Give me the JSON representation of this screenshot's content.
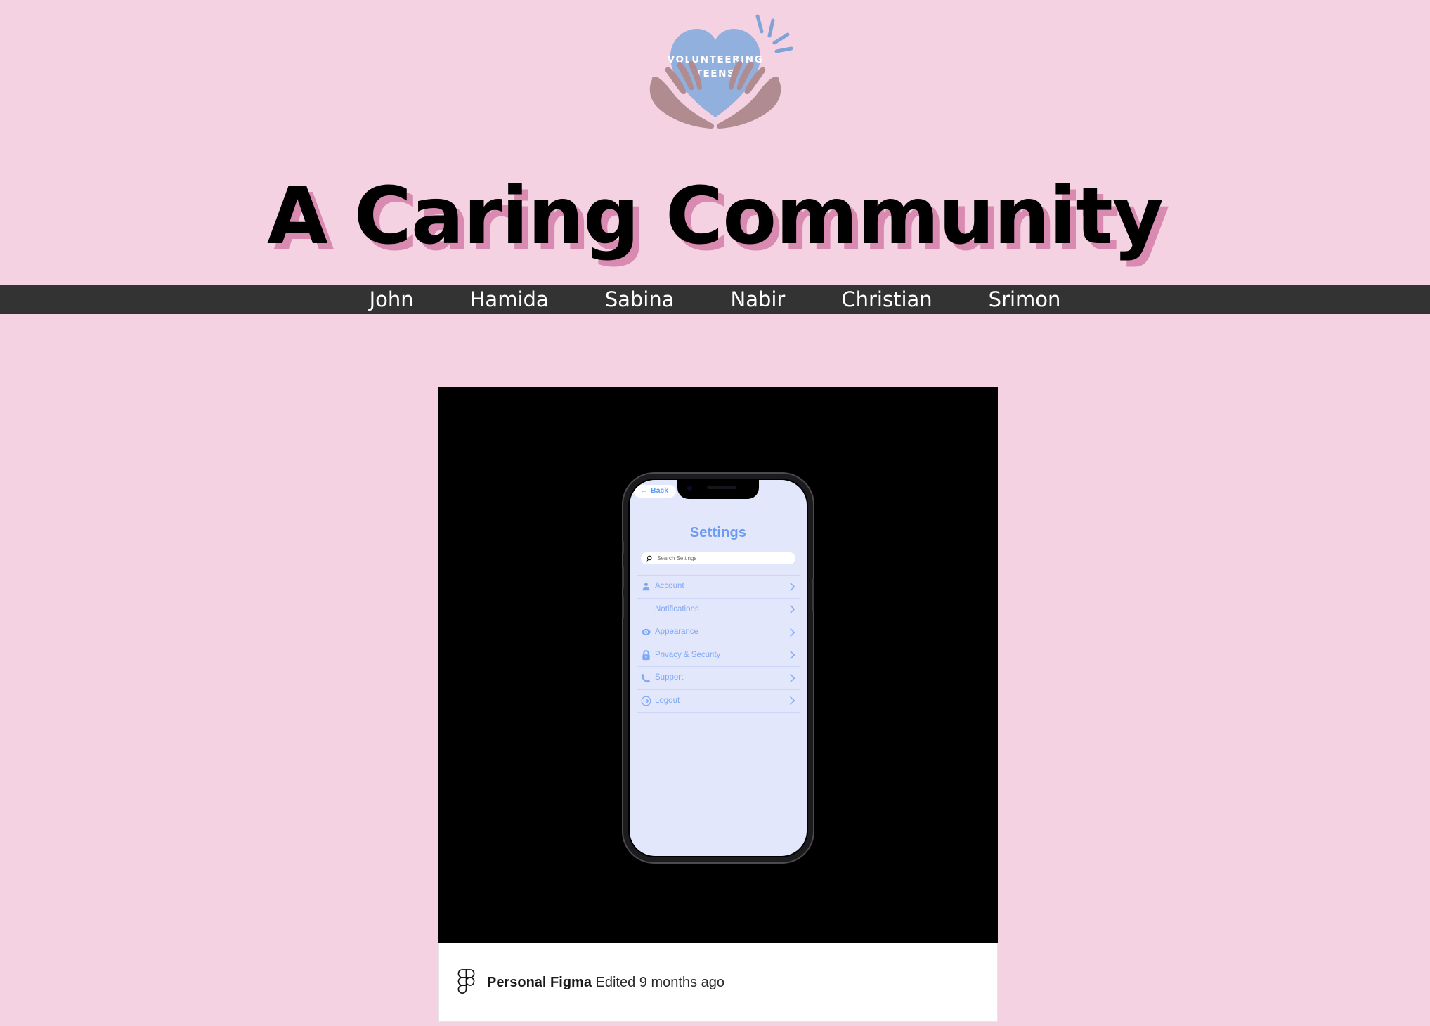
{
  "colors": {
    "page_background": "#f5d2e1",
    "navbar_background": "#333333",
    "title_text": "#000000",
    "title_shadow": "#d98ab0",
    "logo_heart": "#92b0de",
    "logo_hands": "#b08b90",
    "phone_screen": "#e3e7fb",
    "settings_accent": "#7fa8f5",
    "settings_heading": "#6b9bf2",
    "embed_background": "#000000",
    "footer_background": "#ffffff"
  },
  "logo": {
    "name": "volunteering-teens-logo",
    "line1": "VOLUNTEERING",
    "line2": "TEENS",
    "icon": "heart-in-hands-icon"
  },
  "header": {
    "title": "A Caring Community"
  },
  "nav": {
    "items": [
      {
        "label": "John"
      },
      {
        "label": "Hamida"
      },
      {
        "label": "Sabina"
      },
      {
        "label": "Nabir"
      },
      {
        "label": "Christian"
      },
      {
        "label": "Srimon"
      }
    ]
  },
  "embed": {
    "phone": {
      "back_button": {
        "label": "Back",
        "icon": "arrow-left-icon",
        "arrow_glyph": "←"
      },
      "screen_title": "Settings",
      "search": {
        "placeholder": "Search Settings",
        "value": "",
        "icon": "search-icon"
      },
      "menu_items": [
        {
          "label": "Account",
          "icon": "person-icon",
          "chevron": "›"
        },
        {
          "label": "Notifications",
          "icon": "none",
          "chevron": "›"
        },
        {
          "label": "Appearance",
          "icon": "eye-icon",
          "chevron": "›"
        },
        {
          "label": "Privacy & Security",
          "icon": "lock-icon",
          "chevron": "›"
        },
        {
          "label": "Support",
          "icon": "phone-icon",
          "chevron": "›"
        },
        {
          "label": "Logout",
          "icon": "logout-icon",
          "chevron": "›"
        }
      ]
    },
    "footer": {
      "icon": "figma-logo-icon",
      "owner": "Personal Figma",
      "edited": "Edited 9 months ago"
    }
  }
}
